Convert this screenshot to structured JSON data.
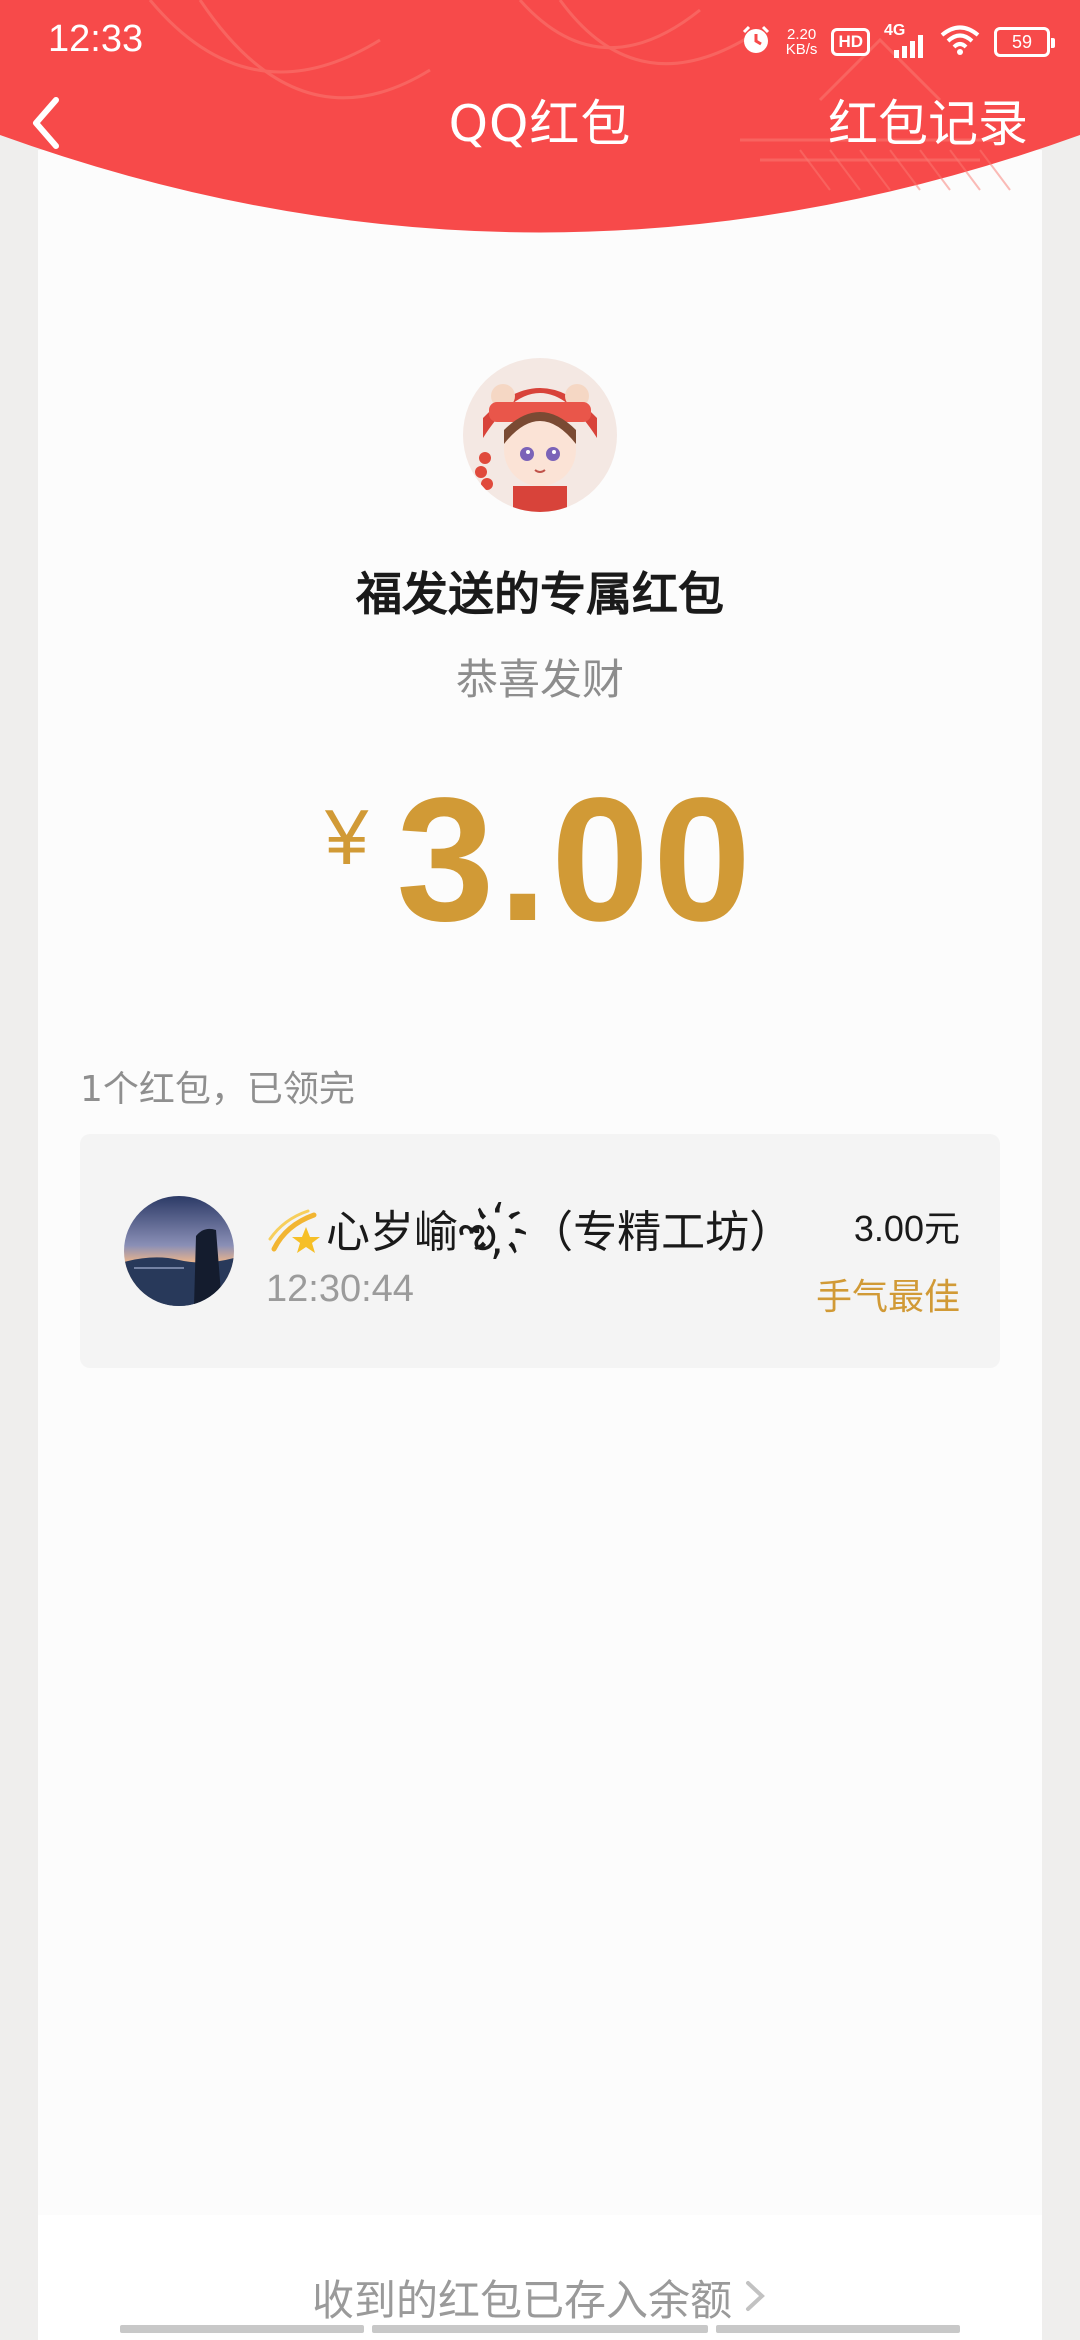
{
  "status_bar": {
    "time": "12:33",
    "net_speed_value": "2.20",
    "net_speed_unit": "KB/s",
    "hd": "HD",
    "network": "4G",
    "battery": "59"
  },
  "nav": {
    "title": "QQ红包",
    "records_link": "红包记录"
  },
  "packet": {
    "sender_title": "福发送的专属红包",
    "greeting": "恭喜发财",
    "currency_symbol": "¥",
    "amount": "3.00"
  },
  "summary": "1个红包，已领完",
  "records": [
    {
      "name": "心岁崳ఌ︎ ҉（专精工坊）",
      "time": "12:30:44",
      "amount": "3.00",
      "amount_unit": "元",
      "badge": "手气最佳"
    }
  ],
  "footer": {
    "balance_link": "收到的红包已存入余额"
  },
  "colors": {
    "header_red": "#f74a4a",
    "amount_gold": "#d19a36",
    "card_bg": "#fcfcfc",
    "page_bg": "#efeeed"
  },
  "icons": {
    "back": "chevron-left-icon",
    "footer_arrow": "chevron-right-icon",
    "alarm": "alarm-icon",
    "wifi": "wifi-icon",
    "signal": "signal-icon",
    "battery": "battery-icon",
    "name_prefix": "dizzy-star-icon"
  }
}
